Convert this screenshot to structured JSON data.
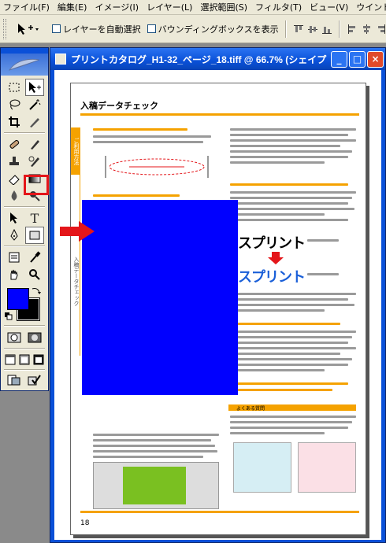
{
  "menu": [
    "ファイル(F)",
    "編集(E)",
    "イメージ(I)",
    "レイヤー(L)",
    "選択範囲(S)",
    "フィルタ(T)",
    "ビュー(V)",
    "ウインドウ"
  ],
  "options": {
    "auto_select_label": "レイヤーを自動選択",
    "bounding_box_label": "バウンディングボックスを表示"
  },
  "document": {
    "title": "プリントカタログ_H1-32_ページ_18.tiff @ 66.7% (シェイプ",
    "page_title": "入稿データチェック",
    "side_tab": "ご利用方法",
    "side_tab2": "入稿データチェック",
    "logo_text_1": "スプリント",
    "logo_text_2": "スプリント",
    "page_number": "18",
    "info_box_label": "よくある質問"
  },
  "colors": {
    "foreground": "#0000ff",
    "background": "#000000",
    "accent": "#f5a200",
    "highlight": "#e4161a"
  }
}
